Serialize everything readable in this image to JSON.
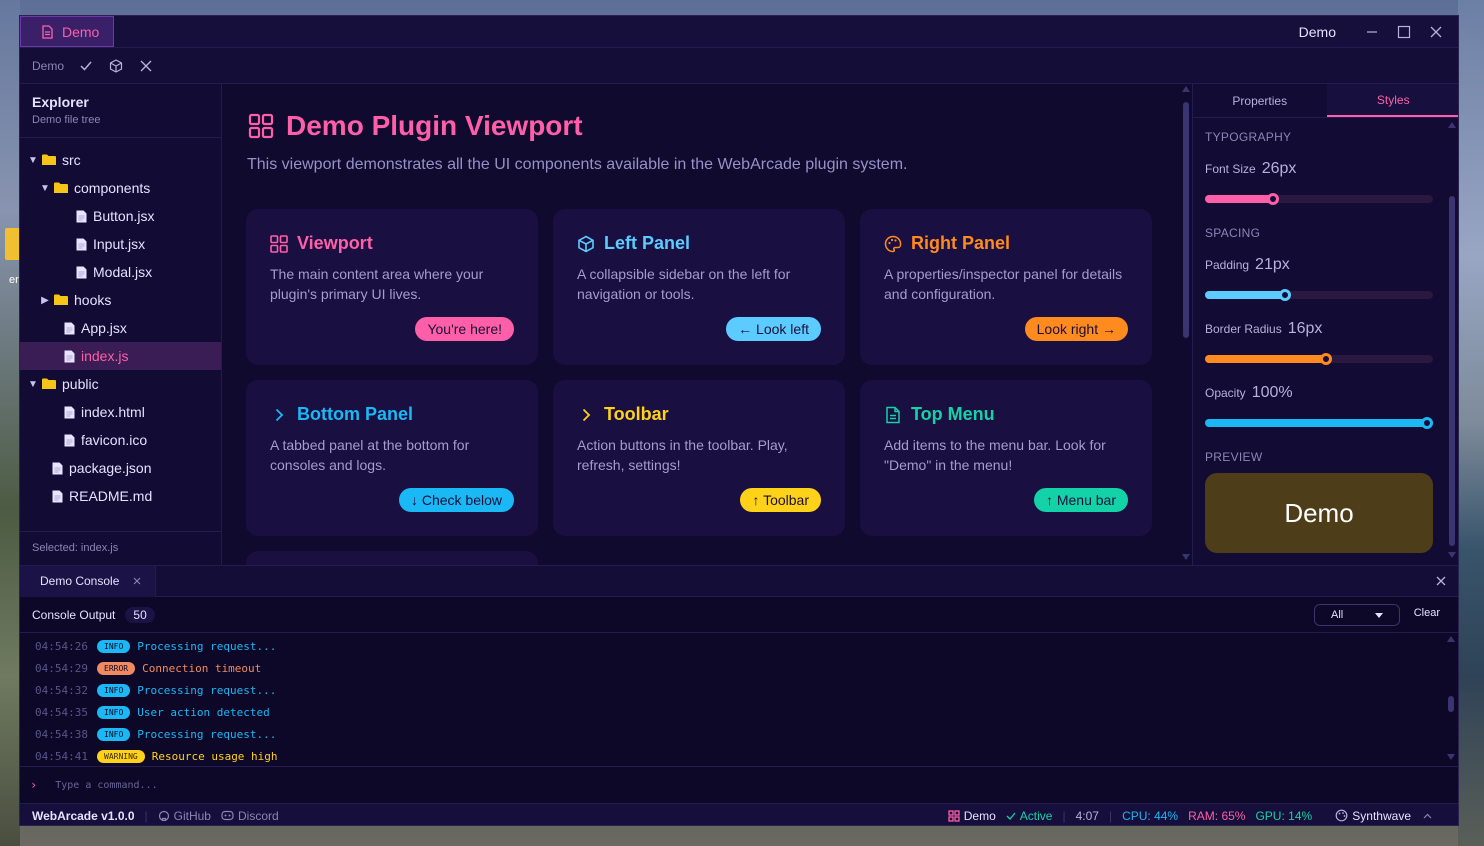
{
  "desktop": {
    "icon_label": "er"
  },
  "window": {
    "tab_label": "Demo",
    "title": "Demo"
  },
  "toolbar": {
    "label": "Demo"
  },
  "sidebar": {
    "title": "Explorer",
    "subtitle": "Demo file tree",
    "tree": [
      {
        "label": "src",
        "kind": "folder",
        "expanded": true,
        "depth": 0
      },
      {
        "label": "components",
        "kind": "folder",
        "expanded": true,
        "depth": 1
      },
      {
        "label": "Button.jsx",
        "kind": "file",
        "depth": 2
      },
      {
        "label": "Input.jsx",
        "kind": "file",
        "depth": 2
      },
      {
        "label": "Modal.jsx",
        "kind": "file",
        "depth": 2
      },
      {
        "label": "hooks",
        "kind": "folder",
        "expanded": false,
        "depth": 1
      },
      {
        "label": "App.jsx",
        "kind": "file",
        "depth": 1
      },
      {
        "label": "index.js",
        "kind": "file",
        "depth": 1,
        "selected": true
      },
      {
        "label": "public",
        "kind": "folder",
        "expanded": true,
        "depth": 0
      },
      {
        "label": "index.html",
        "kind": "file",
        "depth": 1
      },
      {
        "label": "favicon.ico",
        "kind": "file",
        "depth": 1
      },
      {
        "label": "package.json",
        "kind": "file",
        "depth": 0
      },
      {
        "label": "README.md",
        "kind": "file",
        "depth": 0
      }
    ],
    "footer": "Selected: index.js"
  },
  "viewport": {
    "title": "Demo Plugin Viewport",
    "description": "This viewport demonstrates all the UI components available in the WebArcade plugin system.",
    "cards": [
      {
        "title": "Viewport",
        "desc": "The main content area where your plugin's primary UI lives.",
        "button": "You're here!",
        "color": "#ff5fa8",
        "icon": "grid-icon"
      },
      {
        "title": "Left Panel",
        "desc": "A collapsible sidebar on the left for navigation or tools.",
        "button": "← Look left",
        "color": "#5ccbff",
        "icon": "cube-icon"
      },
      {
        "title": "Right Panel",
        "desc": "A properties/inspector panel for details and configuration.",
        "button": "Look right →",
        "color": "#ff8a1e",
        "icon": "palette-icon"
      },
      {
        "title": "Bottom Panel",
        "desc": "A tabbed panel at the bottom for consoles and logs.",
        "button": "↓ Check below",
        "color": "#1ab8f5",
        "icon": "chevron-right-icon"
      },
      {
        "title": "Toolbar",
        "desc": "Action buttons in the toolbar. Play, refresh, settings!",
        "button": "↑ Toolbar",
        "color": "#ffd21a",
        "icon": "chevron-right-icon"
      },
      {
        "title": "Top Menu",
        "desc": "Add items to the menu bar. Look for \"Demo\" in the menu!",
        "button": "↑ Menu bar",
        "color": "#14d2a8",
        "icon": "document-icon"
      }
    ]
  },
  "right_panel": {
    "tabs": [
      {
        "label": "Properties",
        "active": false
      },
      {
        "label": "Styles",
        "active": true
      }
    ],
    "typography_heading": "TYPOGRAPHY",
    "spacing_heading": "SPACING",
    "preview_heading": "PREVIEW",
    "font_size": {
      "label": "Font Size",
      "value": "26px",
      "fraction": 0.3,
      "color": "#ff5fa8"
    },
    "padding": {
      "label": "Padding",
      "value": "21px",
      "fraction": 0.35,
      "color": "#5ccbff"
    },
    "border_radius": {
      "label": "Border Radius",
      "value": "16px",
      "fraction": 0.53,
      "color": "#ff8a1e"
    },
    "opacity": {
      "label": "Opacity",
      "value": "100%",
      "fraction": 1.0,
      "color": "#1ab8f5"
    },
    "preview_text": "Demo"
  },
  "console": {
    "tab_label": "Demo Console",
    "output_label": "Console Output",
    "count": "50",
    "filter_value": "All",
    "clear_label": "Clear",
    "input_placeholder": "Type a command...",
    "logs": [
      {
        "time": "04:54:26",
        "level": "INFO",
        "message": "Processing request..."
      },
      {
        "time": "04:54:29",
        "level": "ERROR",
        "message": "Connection timeout"
      },
      {
        "time": "04:54:32",
        "level": "INFO",
        "message": "Processing request..."
      },
      {
        "time": "04:54:35",
        "level": "INFO",
        "message": "User action detected"
      },
      {
        "time": "04:54:38",
        "level": "INFO",
        "message": "Processing request..."
      },
      {
        "time": "04:54:41",
        "level": "WARNING",
        "message": "Resource usage high"
      }
    ],
    "level_colors": {
      "INFO": "#1ab8f5",
      "ERROR": "#f08a60",
      "WARNING": "#ffd21a"
    }
  },
  "statusbar": {
    "app": "WebArcade v1.0.0",
    "github": "GitHub",
    "discord": "Discord",
    "plugin": "Demo",
    "state": "Active",
    "time": "4:07",
    "cpu": "CPU: 44%",
    "ram": "RAM: 65%",
    "gpu": "GPU: 14%",
    "theme": "Synthwave"
  }
}
